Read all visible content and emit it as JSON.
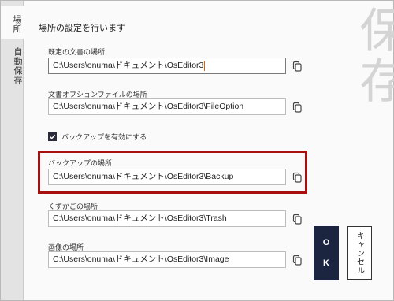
{
  "sidebar": {
    "tabs": [
      {
        "label": "場所",
        "active": true
      },
      {
        "label": "自動保存",
        "active": false
      }
    ]
  },
  "watermark": "保存",
  "page_title": "場所の設定を行います",
  "fields": [
    {
      "label": "既定の文書の場所",
      "value": "C:\\Users\\onuma\\ドキュメント\\OsEditor3"
    },
    {
      "label": "文書オプションファイルの場所",
      "value": "C:\\Users\\onuma\\ドキュメント\\OsEditor3\\FileOption"
    },
    {
      "label": "バックアップの場所",
      "value": "C:\\Users\\onuma\\ドキュメント\\OsEditor3\\Backup"
    },
    {
      "label": "くずかごの場所",
      "value": "C:\\Users\\onuma\\ドキュメント\\OsEditor3\\Trash"
    },
    {
      "label": "画像の場所",
      "value": "C:\\Users\\onuma\\ドキュメント\\OsEditor3\\Image"
    }
  ],
  "backup_checkbox": {
    "label": "バックアップを有効にする",
    "checked": true
  },
  "buttons": {
    "ok_line1": "O",
    "ok_line2": "K",
    "cancel": "キャンセル"
  },
  "colors": {
    "highlight": "#a81010",
    "ok_bg": "#1c2540"
  },
  "icons": {
    "browse": "copy-folder-icon",
    "check": "checkmark-icon"
  }
}
